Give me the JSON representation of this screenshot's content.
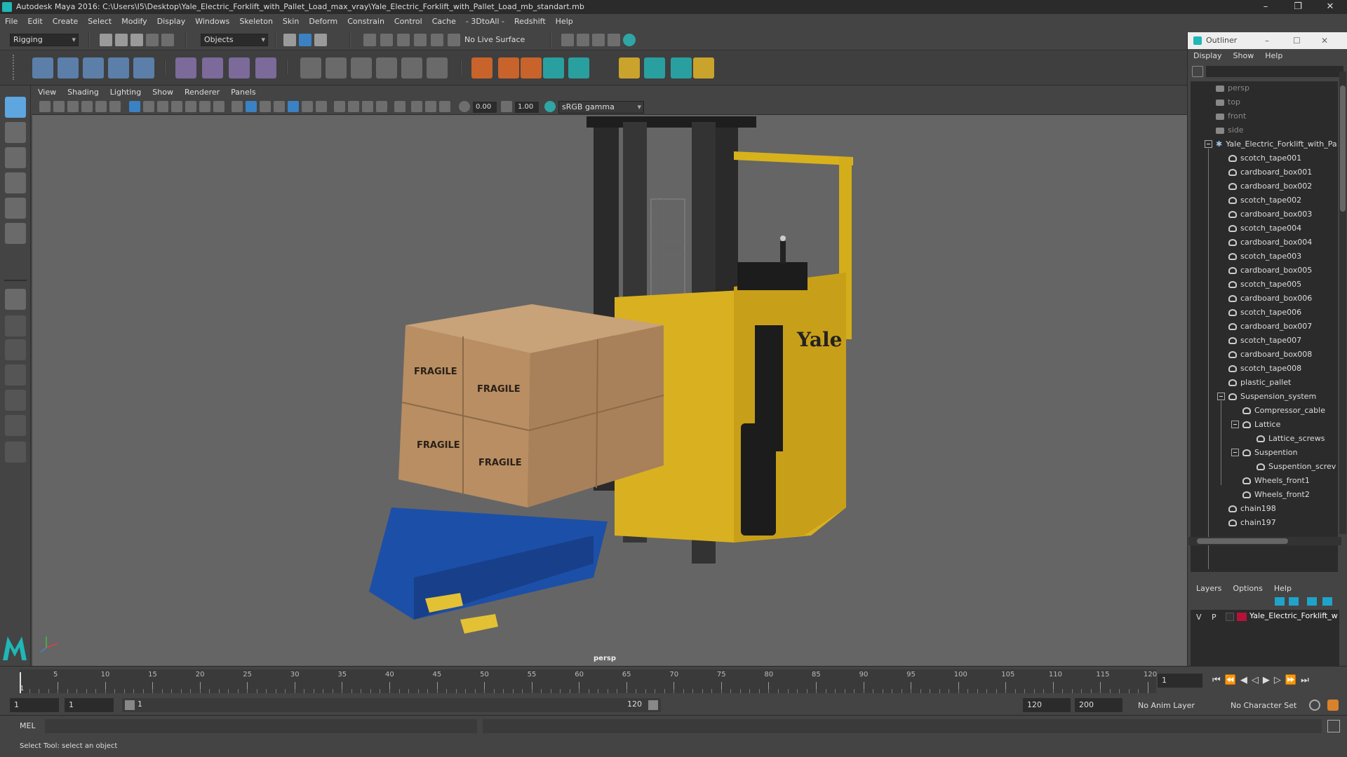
{
  "app": {
    "title": "Autodesk Maya 2016: C:\\Users\\I5\\Desktop\\Yale_Electric_Forklift_with_Pallet_Load_max_vray\\Yale_Electric_Forklift_with_Pallet_Load_mb_standart.mb"
  },
  "menubar": [
    "File",
    "Edit",
    "Create",
    "Select",
    "Modify",
    "Display",
    "Windows",
    "Skeleton",
    "Skin",
    "Deform",
    "Constrain",
    "Control",
    "Cache",
    "- 3DtoAll -",
    "Redshift",
    "Help"
  ],
  "statusline": {
    "menuset": "Rigging",
    "selection_mode": "Objects",
    "live_surface": "No Live Surface"
  },
  "viewport": {
    "menu": [
      "View",
      "Shading",
      "Lighting",
      "Show",
      "Renderer",
      "Panels"
    ],
    "exposure": "0.00",
    "gamma": "1.00",
    "color_space": "sRGB gamma",
    "camera_label": "persp",
    "brand_text": "Yale",
    "box_label": "FRAGILE"
  },
  "outliner": {
    "title": "Outliner",
    "menu": [
      "Display",
      "Show",
      "Help"
    ],
    "cameras": [
      "persp",
      "top",
      "front",
      "side"
    ],
    "root": "Yale_Electric_Forklift_with_Pa",
    "children": [
      "scotch_tape001",
      "cardboard_box001",
      "cardboard_box002",
      "scotch_tape002",
      "cardboard_box003",
      "scotch_tape004",
      "cardboard_box004",
      "scotch_tape003",
      "cardboard_box005",
      "scotch_tape005",
      "cardboard_box006",
      "scotch_tape006",
      "cardboard_box007",
      "scotch_tape007",
      "cardboard_box008",
      "scotch_tape008",
      "plastic_pallet"
    ],
    "suspension": {
      "name": "Suspension_system",
      "compressor": "Compressor_cable",
      "lattice": "Lattice",
      "lattice_screws": "Lattice_screws",
      "suspention": "Suspention",
      "suspention_screws": "Suspention_screv",
      "wheels1": "Wheels_front1",
      "wheels2": "Wheels_front2"
    },
    "tail": [
      "chain198",
      "chain197"
    ]
  },
  "layers": {
    "menu": [
      "Layers",
      "Options",
      "Help"
    ],
    "v": "V",
    "p": "P",
    "layer_name": "Yale_Electric_Forklift_w",
    "layer_color": "#b5123a"
  },
  "timeline": {
    "ticks": [
      "5",
      "10",
      "15",
      "20",
      "25",
      "30",
      "35",
      "40",
      "45",
      "50",
      "55",
      "60",
      "65",
      "70",
      "75",
      "80",
      "85",
      "90",
      "95",
      "100",
      "105",
      "110",
      "115",
      "120"
    ],
    "start_marker": "1",
    "current_frame": "1",
    "range_start": "1",
    "range_inner_start": "1",
    "range_bar_start": "1",
    "range_bar_end": "120",
    "range_end": "120",
    "anim_end": "200",
    "anim_layer": "No Anim Layer",
    "char_set": "No Character Set"
  },
  "cmd": {
    "label": "MEL"
  },
  "help": {
    "text": "Select Tool: select an object"
  }
}
